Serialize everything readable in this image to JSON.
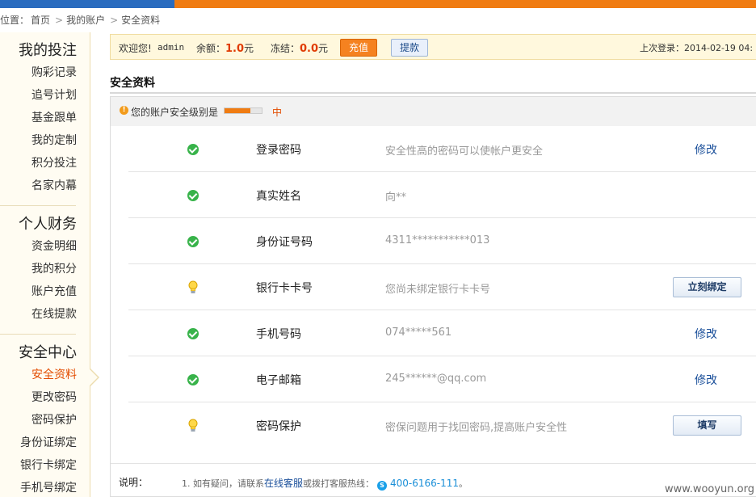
{
  "breadcrumb": {
    "prefix": "位置：",
    "items": [
      "首页",
      "我的账户",
      "安全资料"
    ]
  },
  "sidebar": {
    "groups": [
      {
        "title": "我的投注",
        "items": [
          "购彩记录",
          "追号计划",
          "基金跟单",
          "我的定制",
          "积分投注",
          "名家内幕"
        ]
      },
      {
        "title": "个人财务",
        "items": [
          "资金明细",
          "我的积分",
          "账户充值",
          "在线提款"
        ]
      },
      {
        "title": "安全中心",
        "items": [
          "安全资料",
          "更改密码",
          "密码保护",
          "身份证绑定",
          "银行卡绑定",
          "手机号绑定"
        ]
      }
    ],
    "active_item": "安全资料"
  },
  "infobar": {
    "welcome": "欢迎您!",
    "username": "admin",
    "balance_label": "余额：",
    "balance_value": "1.0",
    "balance_unit": "元",
    "frozen_label": "冻结：",
    "frozen_value": "0.0",
    "frozen_unit": "元",
    "charge_label": "充值",
    "withdraw_label": "提款",
    "last_login": "上次登录：2014-02-19 04:"
  },
  "section": {
    "title": "安全资料"
  },
  "security_level": {
    "label": "您的账户安全级别是",
    "level_text": "中",
    "fraction": 0.7
  },
  "rows": [
    {
      "status": "ok",
      "name": "登录密码",
      "desc": "安全性高的密码可以使帐户更安全",
      "action": "修改",
      "action_type": "link"
    },
    {
      "status": "ok",
      "name": "真实姓名",
      "desc": "向**",
      "action": "",
      "action_type": "none"
    },
    {
      "status": "ok",
      "name": "身份证号码",
      "desc": "4311***********013",
      "action": "",
      "action_type": "none"
    },
    {
      "status": "tip",
      "name": "银行卡卡号",
      "desc": "您尚未绑定银行卡卡号",
      "action": "立刻绑定",
      "action_type": "button"
    },
    {
      "status": "ok",
      "name": "手机号码",
      "desc": "074*****561",
      "action": "修改",
      "action_type": "link"
    },
    {
      "status": "ok",
      "name": "电子邮箱",
      "desc": "245******@qq.com",
      "action": "修改",
      "action_type": "link"
    },
    {
      "status": "tip",
      "name": "密码保护",
      "desc": "密保问题用于找回密码,提高账户安全性",
      "action": "填写",
      "action_type": "button"
    }
  ],
  "note": {
    "label": "说明：",
    "text_before": "1. 如有疑问，请联系",
    "link": "在线客服",
    "text_middle": "或拨打客服热线：",
    "phone": "400-6166-111",
    "text_after": "。"
  },
  "watermark": "www.wooyun.org",
  "colors": {
    "accent_orange": "#f07c12",
    "accent_blue": "#2a6cbf",
    "ok_green": "#38b34a",
    "money_red": "#e03a00"
  }
}
